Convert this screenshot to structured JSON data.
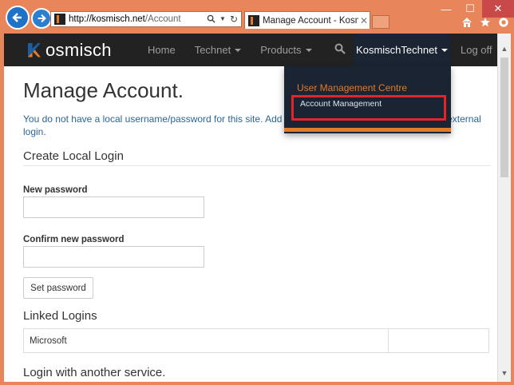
{
  "browser": {
    "address_domain": "http://kosmisch.net",
    "address_path": "/Account",
    "tab_title": "Manage Account - Kosmisc...",
    "tab_close": "✕",
    "window_buttons": [
      "—",
      "☐",
      "✕"
    ],
    "toolbar_icons": [
      "home-icon",
      "star-icon",
      "gear-icon"
    ]
  },
  "nav": {
    "brand": "osmisch",
    "links": [
      "Home",
      "Technet",
      "Products"
    ],
    "user": "KosmischTechnet",
    "logoff": "Log off"
  },
  "dropdown": {
    "header": "User Management Centre",
    "item": "Account Management"
  },
  "page": {
    "title": "Manage Account.",
    "info": "You do not have a local username/password for this site. Add a lo",
    "info_tail": "external",
    "info_line2": "login.",
    "create_local": "Create Local Login",
    "new_password_label": "New password",
    "confirm_password_label": "Confirm new password",
    "set_password": "Set password",
    "linked_logins": "Linked Logins",
    "linked_rows": [
      [
        "Microsoft",
        ""
      ]
    ],
    "login_another": "Login with another service."
  },
  "colors": {
    "browser_frame": "#e9855a",
    "navbar": "#222222",
    "brand_orange": "#e27a2a",
    "link_blue": "#2a6496",
    "highlight_red": "#e0262b"
  }
}
